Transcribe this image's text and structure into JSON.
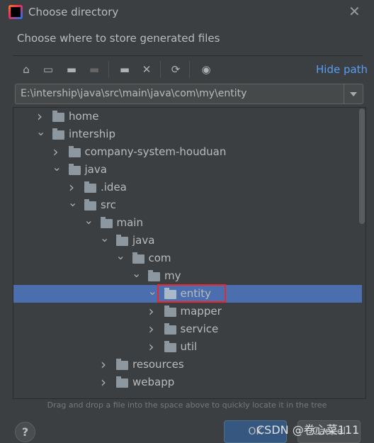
{
  "dialog": {
    "title": "Choose directory",
    "subtitle": "Choose where to store generated files"
  },
  "toolbar": {
    "icons": [
      "home-icon",
      "desktop-icon",
      "project-folder-icon",
      "module-folder-icon",
      "new-folder-icon",
      "delete-icon",
      "refresh-icon",
      "show-hidden-icon"
    ],
    "hide_path": "Hide path"
  },
  "path": {
    "value": "E:\\intership\\java\\src\\main\\java\\com\\my\\entity"
  },
  "tree": {
    "rows": [
      {
        "label": "home",
        "level": 0,
        "expanded": false
      },
      {
        "label": "intership",
        "level": 0,
        "expanded": true
      },
      {
        "label": "company-system-houduan",
        "level": 1,
        "expanded": false
      },
      {
        "label": "java",
        "level": 1,
        "expanded": true
      },
      {
        "label": ".idea",
        "level": 2,
        "expanded": false
      },
      {
        "label": "src",
        "level": 2,
        "expanded": true
      },
      {
        "label": "main",
        "level": 3,
        "expanded": true
      },
      {
        "label": "java",
        "level": 4,
        "expanded": true
      },
      {
        "label": "com",
        "level": 5,
        "expanded": true
      },
      {
        "label": "my",
        "level": 6,
        "expanded": true
      },
      {
        "label": "entity",
        "level": 7,
        "expanded": true,
        "selected": true
      },
      {
        "label": "mapper",
        "level": 7,
        "expanded": false
      },
      {
        "label": "service",
        "level": 7,
        "expanded": false
      },
      {
        "label": "util",
        "level": 7,
        "expanded": false
      },
      {
        "label": "resources",
        "level": 4,
        "expanded": false
      },
      {
        "label": "webapp",
        "level": 4,
        "expanded": false
      }
    ]
  },
  "hint": "Drag and drop a file into the space above to quickly locate it in the tree",
  "buttons": {
    "help": "?",
    "ok": "OK",
    "cancel": "Cancel"
  },
  "watermark": "CSDN @卷心菜111",
  "colors": {
    "selection": "#4b6eaf",
    "link": "#589df6",
    "highlight_box": "#e8282d"
  }
}
